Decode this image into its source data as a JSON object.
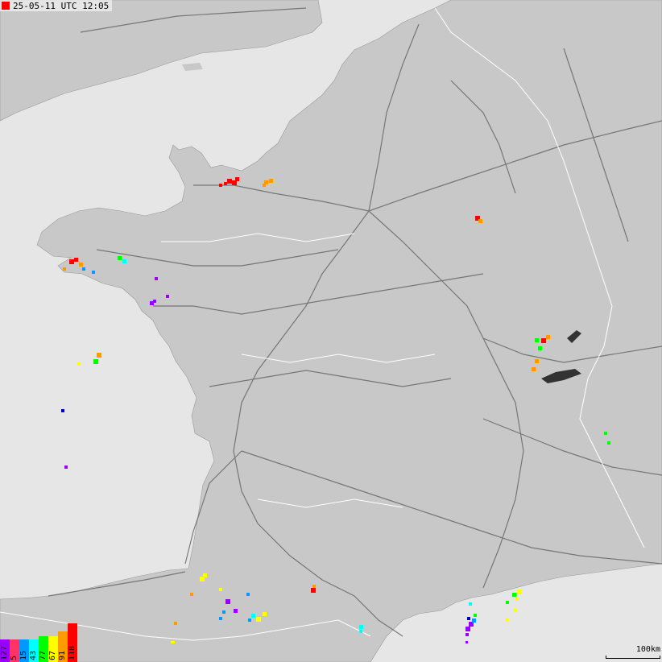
{
  "header": {
    "timestamp": "25-05-11 UTC 12:05",
    "marker_color": "#ff0000"
  },
  "legend": {
    "items": [
      {
        "label": "127",
        "color": "#9900ff"
      },
      {
        "label": "5",
        "color": "#ff3366"
      },
      {
        "label": "15",
        "color": "#0099ff"
      },
      {
        "label": "43",
        "color": "#00ffff"
      },
      {
        "label": "77",
        "color": "#00ff00"
      },
      {
        "label": "67",
        "color": "#ffff00"
      },
      {
        "label": "91",
        "color": "#ff9900"
      },
      {
        "label": "118",
        "color": "#ff0000"
      }
    ]
  },
  "scale": {
    "label": "100km"
  },
  "colors": {
    "sea": "#e6e6e6",
    "land": "#c8c8c8",
    "roads": "#6e6e6e",
    "borders": "#ffffff"
  }
}
